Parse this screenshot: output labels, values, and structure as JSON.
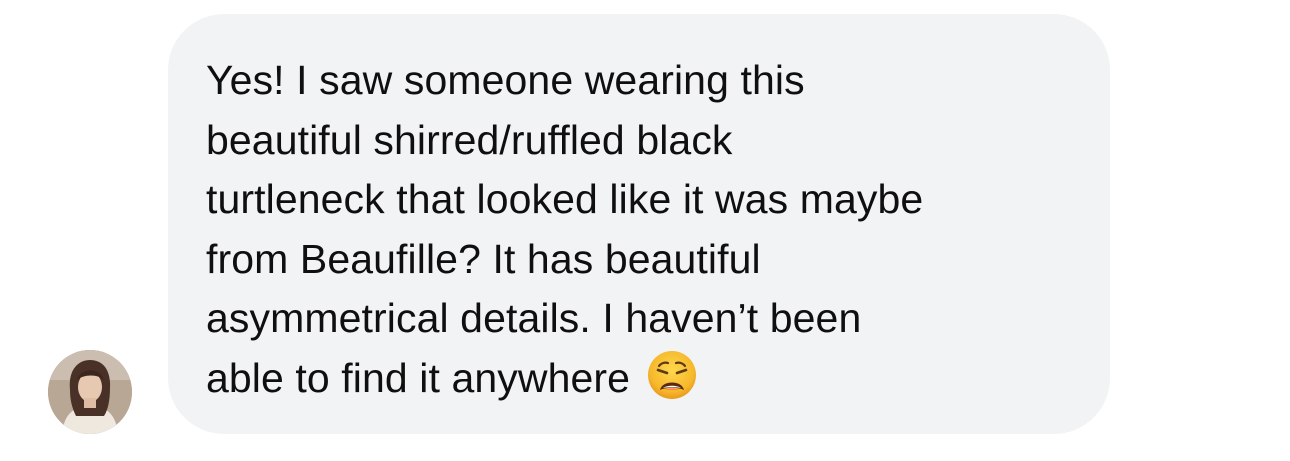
{
  "message": {
    "text": "Yes! I saw someone wearing this\nbeautiful shirred/ruffled black\nturtleneck that looked like it was maybe\nfrom Beaufille? It has beautiful\nasymmetrical details. I haven’t been\nable to find it anywhere",
    "emoji": "weary-face-emoji",
    "bubble_color": "#f2f3f5",
    "text_color": "#0f0f10"
  },
  "sender": {
    "avatar": "profile-photo-avatar"
  }
}
